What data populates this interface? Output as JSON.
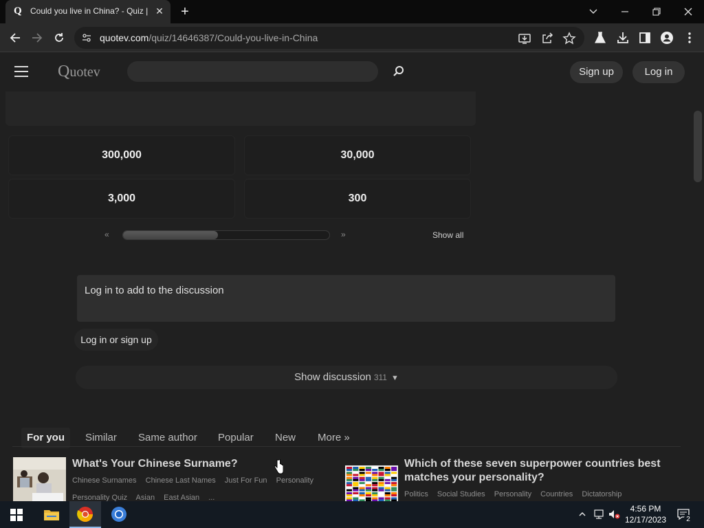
{
  "browser": {
    "tab_title": "Could you live in China? - Quiz |",
    "favicon_letter": "Q",
    "url_domain": "quotev.com",
    "url_path": "/quiz/14646387/Could-you-live-in-China"
  },
  "site": {
    "logo_q": "Q",
    "logo_rest": "uotev",
    "search_placeholder": "",
    "signup_label": "Sign up",
    "login_label": "Log in"
  },
  "answers": [
    "300,000",
    "30,000",
    "3,000",
    "300"
  ],
  "pager": {
    "prev": "«",
    "next": "»",
    "show_all": "Show all",
    "progress_fraction": 0.46
  },
  "discussion": {
    "prompt": "Log in to add to the discussion",
    "login_button": "Log in or sign up",
    "show_label": "Show discussion",
    "count": "311",
    "arrow": "▼"
  },
  "rec_tabs": [
    {
      "label": "For you"
    },
    {
      "label": "Similar"
    },
    {
      "label": "Same author"
    },
    {
      "label": "Popular"
    },
    {
      "label": "New"
    },
    {
      "label": "More »"
    }
  ],
  "recommendations": [
    {
      "title": "What's Your Chinese Surname?",
      "tags_line1": [
        "Chinese Surnames",
        "Chinese Last Names",
        "Just For Fun",
        "Personality"
      ],
      "tags_line2": [
        "Personality Quiz",
        "Asian",
        "East Asian",
        "..."
      ]
    },
    {
      "title": "Which of these seven superpower countries best matches your personality?",
      "tags_line1": [
        "Politics",
        "Social Studies",
        "Personality",
        "Countries",
        "Dictatorship"
      ]
    }
  ],
  "taskbar": {
    "time": "4:56 PM",
    "date": "12/17/2023",
    "notifications": "2"
  }
}
